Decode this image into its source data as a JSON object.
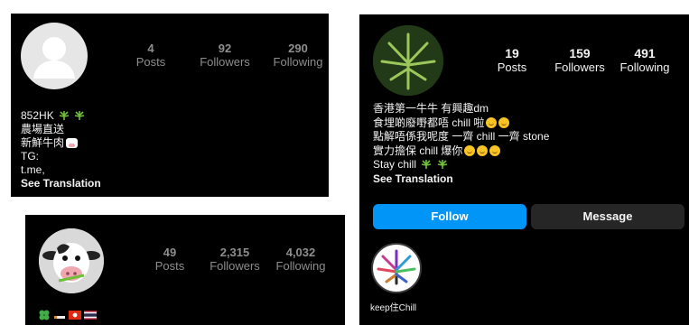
{
  "profile_a": {
    "stats": [
      {
        "num": "4",
        "label": "Posts"
      },
      {
        "num": "92",
        "label": "Followers"
      },
      {
        "num": "290",
        "label": "Following"
      }
    ],
    "bio_lines": [
      "852HK",
      "農場直送",
      "新鮮牛肉",
      "TG:",
      "t.me,"
    ],
    "see_translation": "See Translation"
  },
  "profile_b": {
    "stats": [
      {
        "num": "49",
        "label": "Posts"
      },
      {
        "num": "2,315",
        "label": "Followers"
      },
      {
        "num": "4,032",
        "label": "Following"
      }
    ]
  },
  "profile_c": {
    "stats": [
      {
        "num": "19",
        "label": "Posts"
      },
      {
        "num": "159",
        "label": "Followers"
      },
      {
        "num": "491",
        "label": "Following"
      }
    ],
    "bio_lines": [
      "香港第一牛牛 有興趣dm",
      "食埋啲廢嘢都唔 chill 啦",
      "點解唔係我呢度 一齊 chill 一齊 stone",
      "實力擔保 chill 爆你",
      "Stay chill"
    ],
    "see_translation": "See Translation",
    "follow_label": "Follow",
    "message_label": "Message",
    "highlight_label": "keep住Chill"
  },
  "colors": {
    "follow_blue": "#0095f6",
    "panel_bg": "#000000",
    "message_bg": "#262626"
  },
  "icons": [
    "leaf-icon",
    "grinning-face-icon",
    "cow-face-icon",
    "clover-icon",
    "flag-hk-icon",
    "flag-th-icon"
  ]
}
